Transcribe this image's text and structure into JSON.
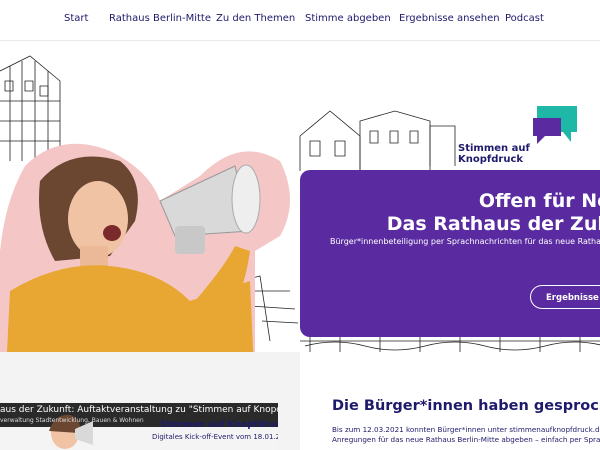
{
  "nav": {
    "items": [
      {
        "label": "Start"
      },
      {
        "label": "Rathaus Berlin-Mitte"
      },
      {
        "label": "Zu den Themen"
      },
      {
        "label": "Stimme abgeben"
      },
      {
        "label": "Ergebnisse ansehen"
      },
      {
        "label": "Podcast"
      }
    ]
  },
  "brand": {
    "line1": "Stimmen auf",
    "line2": "Knopfdruck",
    "logo_colors": [
      "#1fb8a6",
      "#5a2aa0"
    ]
  },
  "hero": {
    "title_line1": "Offen für Ne",
    "title_line2": "Das Rathaus der Zuk",
    "subtitle": "Bürger*innenbeteiligung per Sprachnachrichten für das neue Ratha",
    "button_label": "Ergebnisse an",
    "banner_color": "#5a2aa0"
  },
  "video": {
    "title": "aus der Zukunft: Auftaktveranstaltung zu \"Stimmen auf Knopdruck",
    "channel": "verwaltung Stadtentwicklung, Bauen & Wohnen",
    "brand": "Stimmen auf Knopfdruck",
    "caption": "Digitales Kick-off-Event vom 18.01.2021"
  },
  "results": {
    "title": "Die Bürger*innen haben gesprochen",
    "text_line1": "Bis zum 12.03.2021 konnten Bürger*innen unter stimmenaufknopfdruck.de ihre Ide",
    "text_line2": "Anregungen für das neue Rathaus Berlin-Mitte abgeben – einfach per Sprachnachri"
  }
}
